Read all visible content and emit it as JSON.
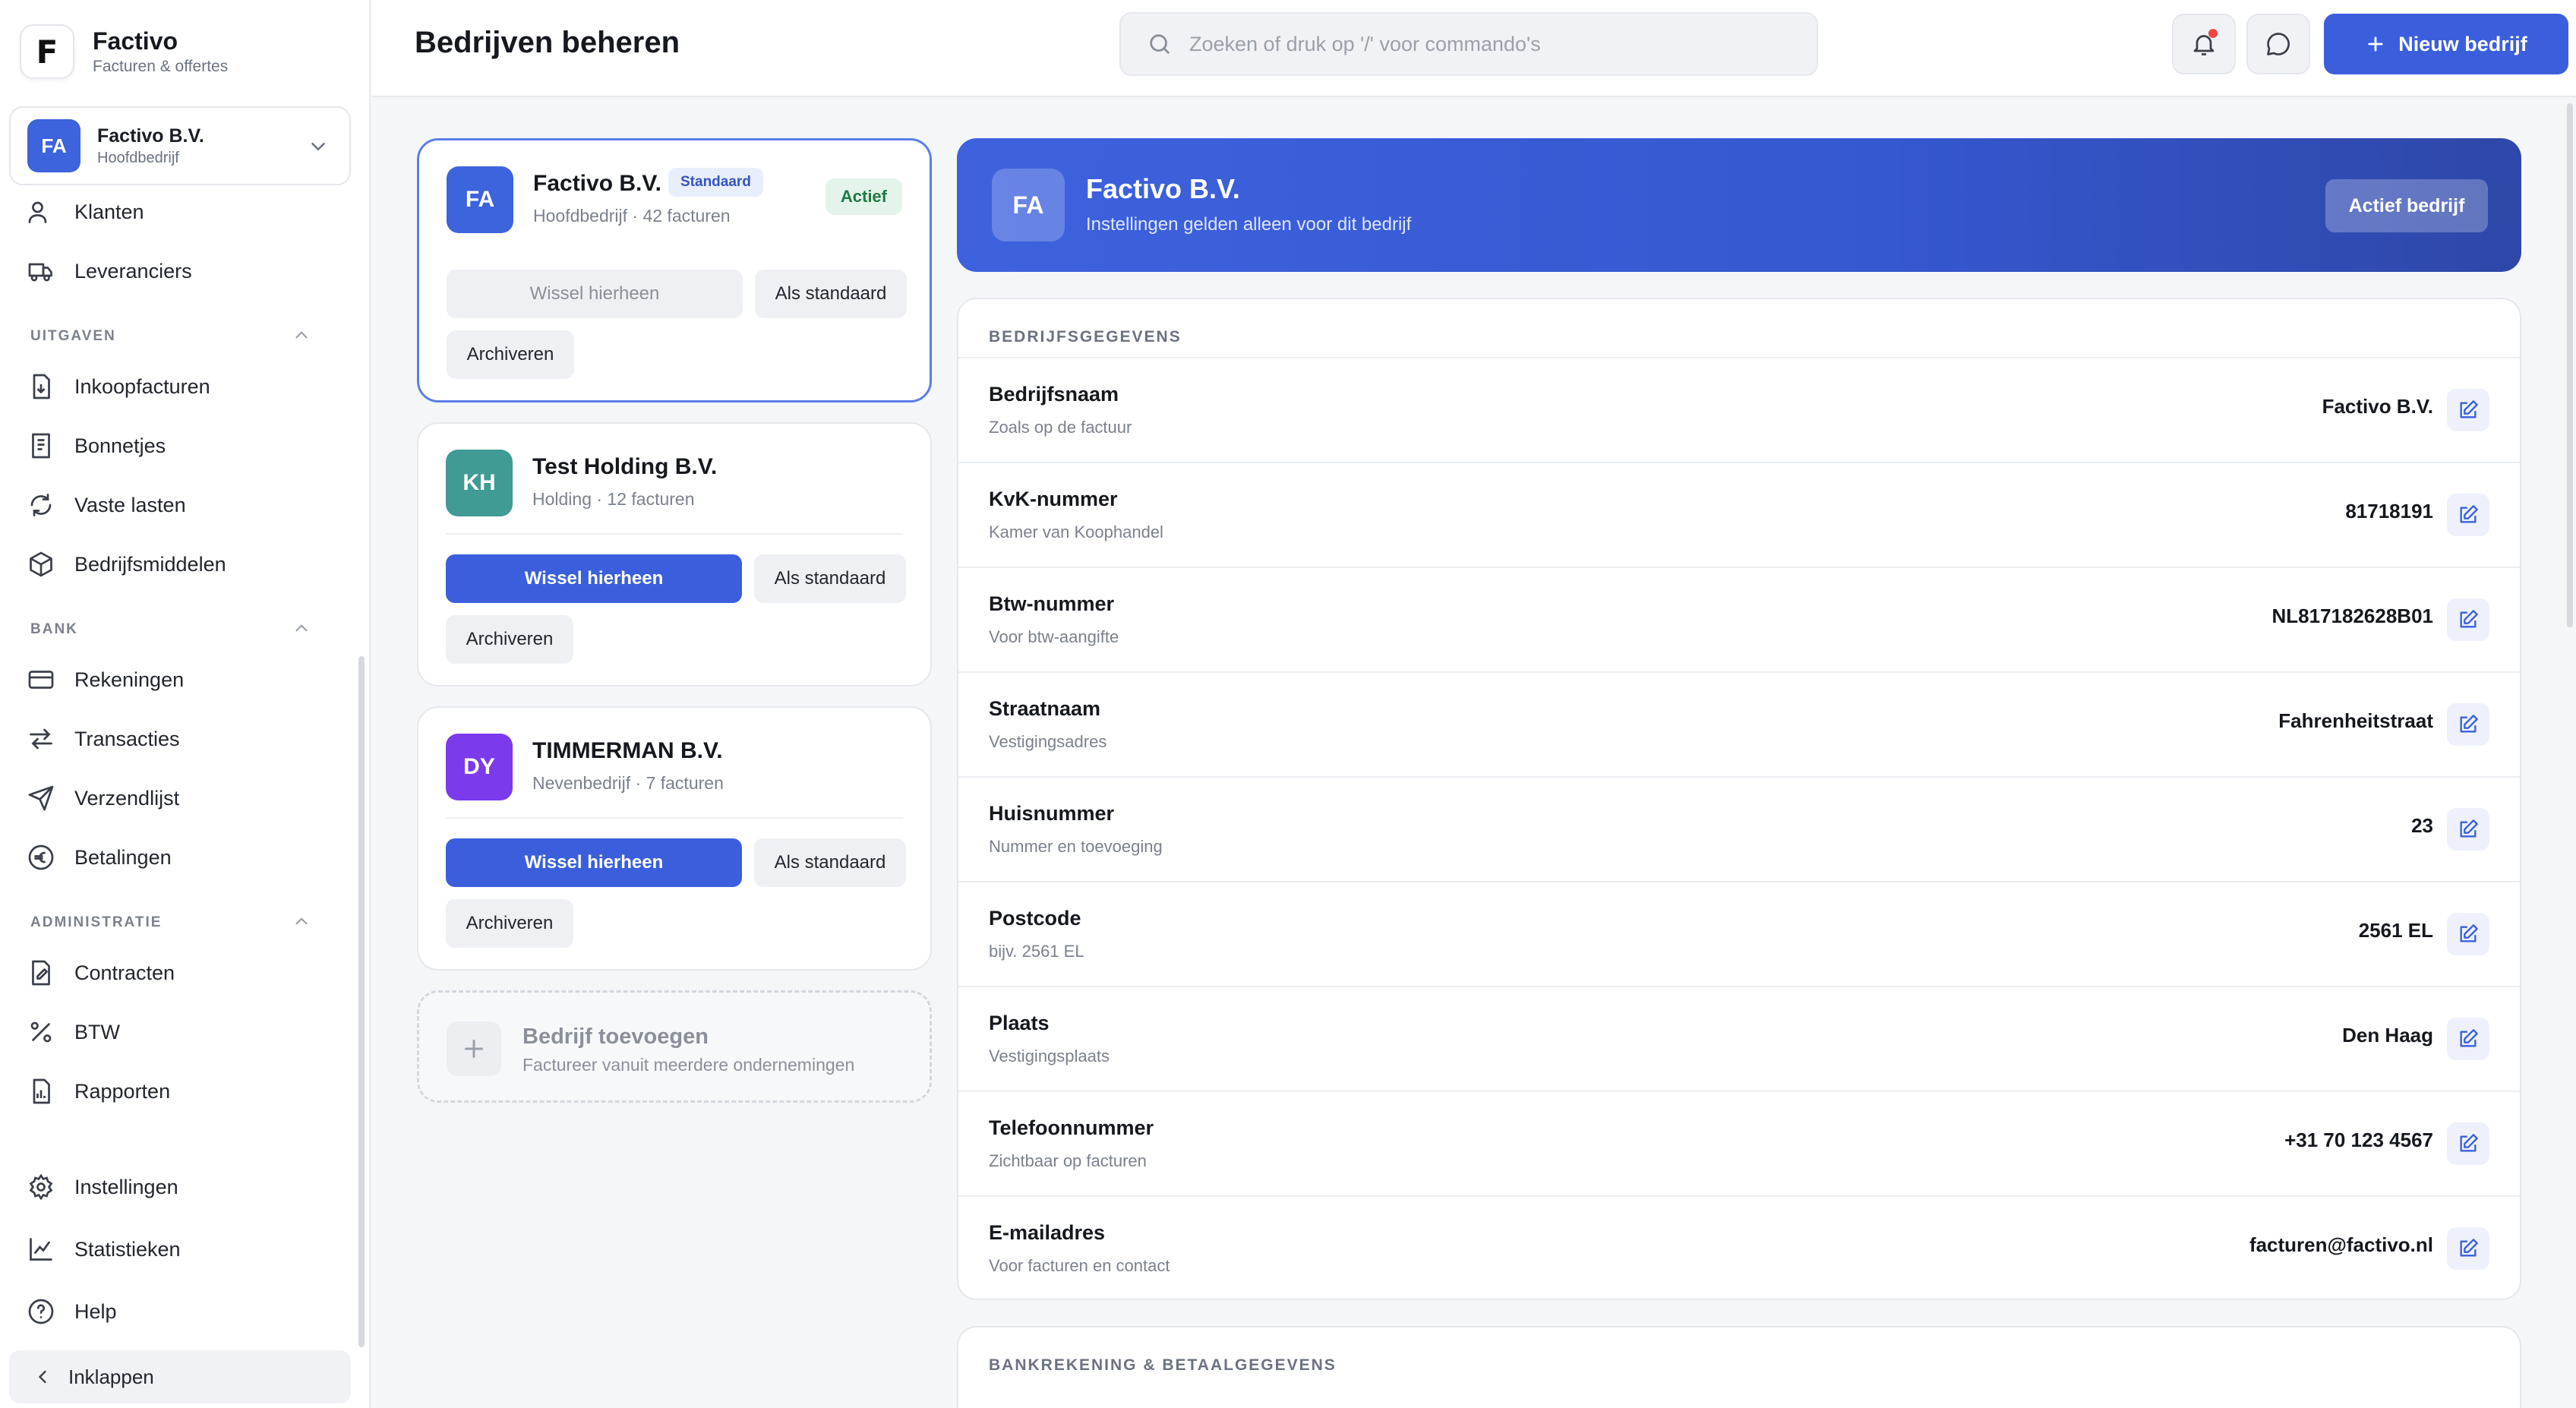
{
  "brand": {
    "name": "Factivo",
    "subtitle": "Facturen & offertes",
    "logo_letter": "F"
  },
  "company_switcher": {
    "initials": "FA",
    "name": "Factivo B.V.",
    "subtitle": "Hoofdbedrijf"
  },
  "sidebar": {
    "top_items": [
      {
        "label": "Klanten",
        "icon": "users-icon"
      },
      {
        "label": "Leveranciers",
        "icon": "truck-icon"
      }
    ],
    "sections": [
      {
        "title": "UITGAVEN",
        "items": [
          {
            "label": "Inkoopfacturen",
            "icon": "file-download-icon"
          },
          {
            "label": "Bonnetjes",
            "icon": "receipt-icon"
          },
          {
            "label": "Vaste lasten",
            "icon": "refresh-icon"
          },
          {
            "label": "Bedrijfsmiddelen",
            "icon": "box-icon"
          }
        ]
      },
      {
        "title": "BANK",
        "items": [
          {
            "label": "Rekeningen",
            "icon": "credit-card-icon"
          },
          {
            "label": "Transacties",
            "icon": "arrows-icon"
          },
          {
            "label": "Verzendlijst",
            "icon": "send-icon"
          },
          {
            "label": "Betalingen",
            "icon": "euro-icon"
          }
        ]
      },
      {
        "title": "ADMINISTRATIE",
        "items": [
          {
            "label": "Contracten",
            "icon": "contract-icon"
          },
          {
            "label": "BTW",
            "icon": "percent-icon"
          },
          {
            "label": "Rapporten",
            "icon": "report-icon"
          }
        ]
      }
    ],
    "bottom_items": [
      {
        "label": "Instellingen",
        "icon": "gear-icon"
      },
      {
        "label": "Statistieken",
        "icon": "chart-icon"
      },
      {
        "label": "Help",
        "icon": "help-icon"
      }
    ],
    "collapse_label": "Inklappen"
  },
  "header": {
    "title": "Bedrijven beheren",
    "search_placeholder": "Zoeken of druk op '/' voor commando's",
    "new_button": "Nieuw bedrijf"
  },
  "companies": [
    {
      "initials": "FA",
      "name": "Factivo B.V.",
      "subtitle": "Hoofdbedrijf · 42 facturen",
      "badge": "Standaard",
      "status": "Actief",
      "avatar_color": "#3d63dd",
      "switch_label": "Wissel hierheen",
      "default_label": "Als standaard",
      "archive_label": "Archiveren"
    },
    {
      "initials": "KH",
      "name": "Test Holding B.V.",
      "subtitle": "Holding · 12 facturen",
      "avatar_color": "#3f9b93",
      "switch_label": "Wissel hierheen",
      "default_label": "Als standaard",
      "archive_label": "Archiveren"
    },
    {
      "initials": "DY",
      "name": "TIMMERMAN B.V.",
      "subtitle": "Nevenbedrijf · 7 facturen",
      "avatar_color": "#7c3aed",
      "switch_label": "Wissel hierheen",
      "default_label": "Als standaard",
      "archive_label": "Archiveren"
    }
  ],
  "add_company": {
    "title": "Bedrijf toevoegen",
    "subtitle": "Factureer vanuit meerdere ondernemingen"
  },
  "active_company": {
    "initials": "FA",
    "name": "Factivo B.V.",
    "subtitle": "Instellingen gelden alleen voor dit bedrijf",
    "button": "Actief bedrijf"
  },
  "details": {
    "title": "BEDRIJFSGEGEVENS",
    "fields": [
      {
        "label": "Bedrijfsnaam",
        "hint": "Zoals op de factuur",
        "value": "Factivo B.V."
      },
      {
        "label": "KvK-nummer",
        "hint": "Kamer van Koophandel",
        "value": "81718191"
      },
      {
        "label": "Btw-nummer",
        "hint": "Voor btw-aangifte",
        "value": "NL817182628B01"
      },
      {
        "label": "Straatnaam",
        "hint": "Vestigingsadres",
        "value": "Fahrenheitstraat"
      },
      {
        "label": "Huisnummer",
        "hint": "Nummer en toevoeging",
        "value": "23"
      },
      {
        "label": "Postcode",
        "hint": "bijv. 2561 EL",
        "value": "2561 EL"
      },
      {
        "label": "Plaats",
        "hint": "Vestigingsplaats",
        "value": "Den Haag"
      },
      {
        "label": "Telefoonnummer",
        "hint": "Zichtbaar op facturen",
        "value": "+31 70 123 4567"
      },
      {
        "label": "E-mailadres",
        "hint": "Voor facturen en contact",
        "value": "facturen@factivo.nl"
      }
    ]
  },
  "bank_panel": {
    "title": "BANKREKENING & BETAALGEGEVENS"
  },
  "colors": {
    "primary": "#3b5fdc",
    "active_badge": "#1f7a45",
    "standaard_badge": "#3553c2"
  }
}
